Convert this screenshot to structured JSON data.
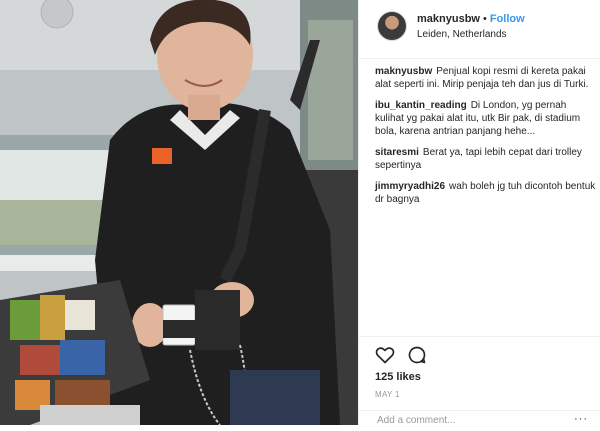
{
  "header": {
    "username": "maknyusbw",
    "separator": "•",
    "follow_label": "Follow",
    "location": "Leiden, Netherlands"
  },
  "comments": [
    {
      "user": "maknyusbw",
      "text": "Penjual kopi resmi di kereta pakai alat seperti ini. Mirip penjaja teh dan jus di Turki."
    },
    {
      "user": "ibu_kantin_reading",
      "text": "Di London, yg pernah kulihat yg pakai alat itu, utk Bir pak, di stadium bola, karena antrian panjang hehe..."
    },
    {
      "user": "sitaresmi",
      "text": "Berat ya, tapi lebih cepat dari trolley sepertinya"
    },
    {
      "user": "jimmyryadhi26",
      "text": "wah boleh jg tuh dicontoh bentuk dr bagnya"
    }
  ],
  "actions": {
    "like_icon": "heart-icon",
    "comment_icon": "speech-bubble-icon",
    "likes": "125 likes",
    "date": "MAY 1",
    "add_comment_placeholder": "Add a comment...",
    "more_icon": "ellipsis-icon",
    "more_label": "···"
  },
  "colors": {
    "follow": "#3897f0",
    "text": "#262626",
    "muted": "#999999",
    "divider": "#efefef"
  }
}
